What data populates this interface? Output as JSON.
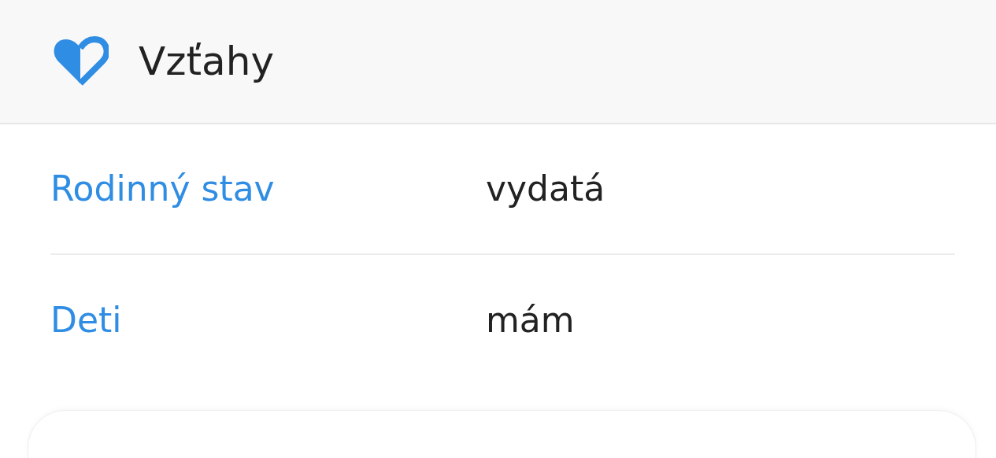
{
  "header": {
    "title": "Vzťahy"
  },
  "rows": [
    {
      "label": "Rodinný stav",
      "value": "vydatá"
    },
    {
      "label": "Deti",
      "value": "mám"
    }
  ]
}
